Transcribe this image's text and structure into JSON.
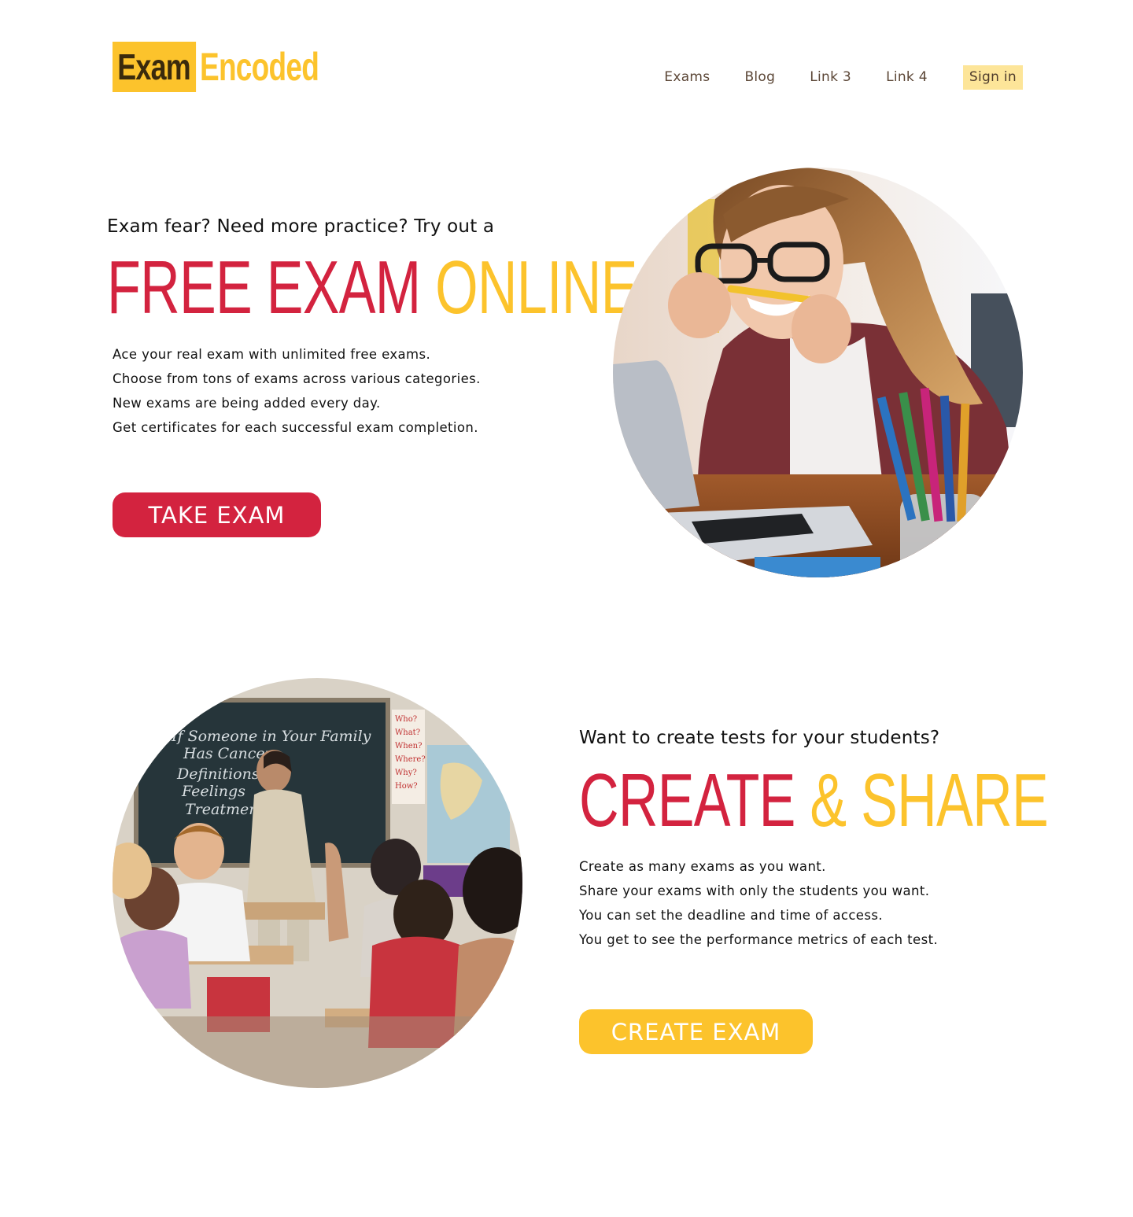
{
  "header": {
    "logo_part1": "Exam",
    "logo_part2": "Encoded",
    "nav": [
      "Exams",
      "Blog",
      "Link 3",
      "Link 4"
    ],
    "signin": "Sign in"
  },
  "hero": {
    "eyebrow": "Exam fear? Need more practice? Try out a",
    "headline_red": "FREE EXAM",
    "headline_gold": "ONLINE",
    "lines": [
      "Ace your real exam with unlimited free exams.",
      "Choose from tons of exams across various categories.",
      "New exams are being added every day.",
      "Get certificates for each successful exam completion."
    ],
    "button": "TAKE EXAM"
  },
  "create": {
    "eyebrow": "Want to create tests for your students?",
    "headline_red": "CREATE",
    "headline_gold": "& SHARE",
    "lines": [
      "Create as many exams as you want.",
      "Share your exams with only the students you want.",
      "You can set the deadline and time of access.",
      "You get to see the performance metrics of each test."
    ],
    "button": "CREATE EXAM",
    "blackboard_lines": [
      "If Someone in Your Family",
      "Has Cancer",
      "Definitions",
      "Feelings",
      "Treatment"
    ],
    "side_cards": [
      "Who?",
      "What?",
      "When?",
      "Where?",
      "Why?",
      "How?"
    ]
  },
  "colors": {
    "red": "#d3233f",
    "gold": "#fcc32c",
    "nav_text": "#5b4636",
    "signin_bg": "#fde599"
  }
}
